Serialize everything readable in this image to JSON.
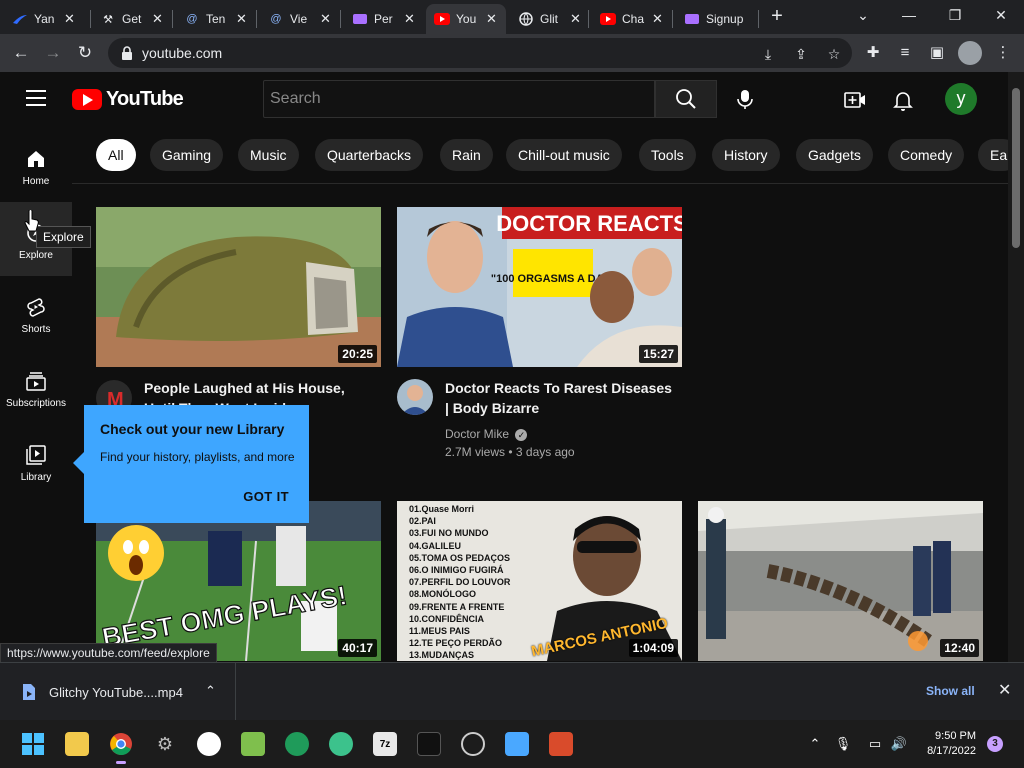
{
  "browser": {
    "tabs": [
      {
        "title": "Yan",
        "icon": "swoosh-icon"
      },
      {
        "title": "Get",
        "icon": "tools-icon"
      },
      {
        "title": "Ten",
        "icon": "at-icon"
      },
      {
        "title": "Vie",
        "icon": "at-icon"
      },
      {
        "title": "Per",
        "icon": "purple-app-icon"
      },
      {
        "title": "You",
        "icon": "youtube-icon",
        "active": true
      },
      {
        "title": "Glit",
        "icon": "globe-icon"
      },
      {
        "title": "Cha",
        "icon": "youtube-icon"
      },
      {
        "title": "Signup",
        "icon": "purple-app-icon"
      }
    ],
    "url": "youtube.com",
    "status_url": "https://www.youtube.com/feed/explore"
  },
  "header": {
    "logo_text": "YouTube",
    "search_placeholder": "Search",
    "avatar_letter": "y"
  },
  "sidebar": {
    "items": [
      {
        "label": "Home"
      },
      {
        "label": "Explore"
      },
      {
        "label": "Shorts"
      },
      {
        "label": "Subscriptions"
      },
      {
        "label": "Library"
      }
    ],
    "tooltip": "Explore"
  },
  "chips": [
    "All",
    "Gaming",
    "Music",
    "Quarterbacks",
    "Rain",
    "Chill-out music",
    "Tools",
    "History",
    "Gadgets",
    "Comedy",
    "Ea"
  ],
  "videos": [
    {
      "duration": "20:25",
      "title_line1": "People Laughed at His House,",
      "title_line2": "Until They Went Inside"
    },
    {
      "duration": "15:27",
      "title_line1": "Doctor Reacts To Rarest Diseases",
      "title_line2": "| Body Bizarre",
      "channel": "Doctor Mike",
      "meta": "2.7M views • 3 days ago",
      "thumb_text1": "DOCTOR REACTS",
      "thumb_text2": "\"100 ORGASMS A DAY\""
    },
    {
      "duration": "40:17",
      "thumb_text": "BEST OMG PLAYS!"
    },
    {
      "duration": "1:04:09",
      "tracklist": [
        "01.Quase Morri",
        "02.PAI",
        "03.FUI NO MUNDO",
        "04.GALILEU",
        "05.TOMA OS PEDAÇOS",
        "06.O INIMIGO FUGIRÁ",
        "07.PERFIL DO LOUVOR",
        "08.MONÓLOGO",
        "09.FRENTE A FRENTE",
        "10.CONFIDÊNCIA",
        "11.MEUS PAIS",
        "12.TE PEÇO PERDÃO",
        "13.MUDANÇAS"
      ],
      "thumb_text": "MARCOS ANTONIO"
    },
    {
      "duration": "12:40"
    }
  ],
  "popup": {
    "title": "Check out your new Library",
    "subtitle": "Find your history, playlists, and more",
    "button": "GOT IT"
  },
  "download": {
    "filename": "Glitchy YouTube....mp4",
    "show_all": "Show all"
  },
  "taskbar": {
    "time": "9:50 PM",
    "date": "8/17/2022",
    "notifications": "3"
  }
}
